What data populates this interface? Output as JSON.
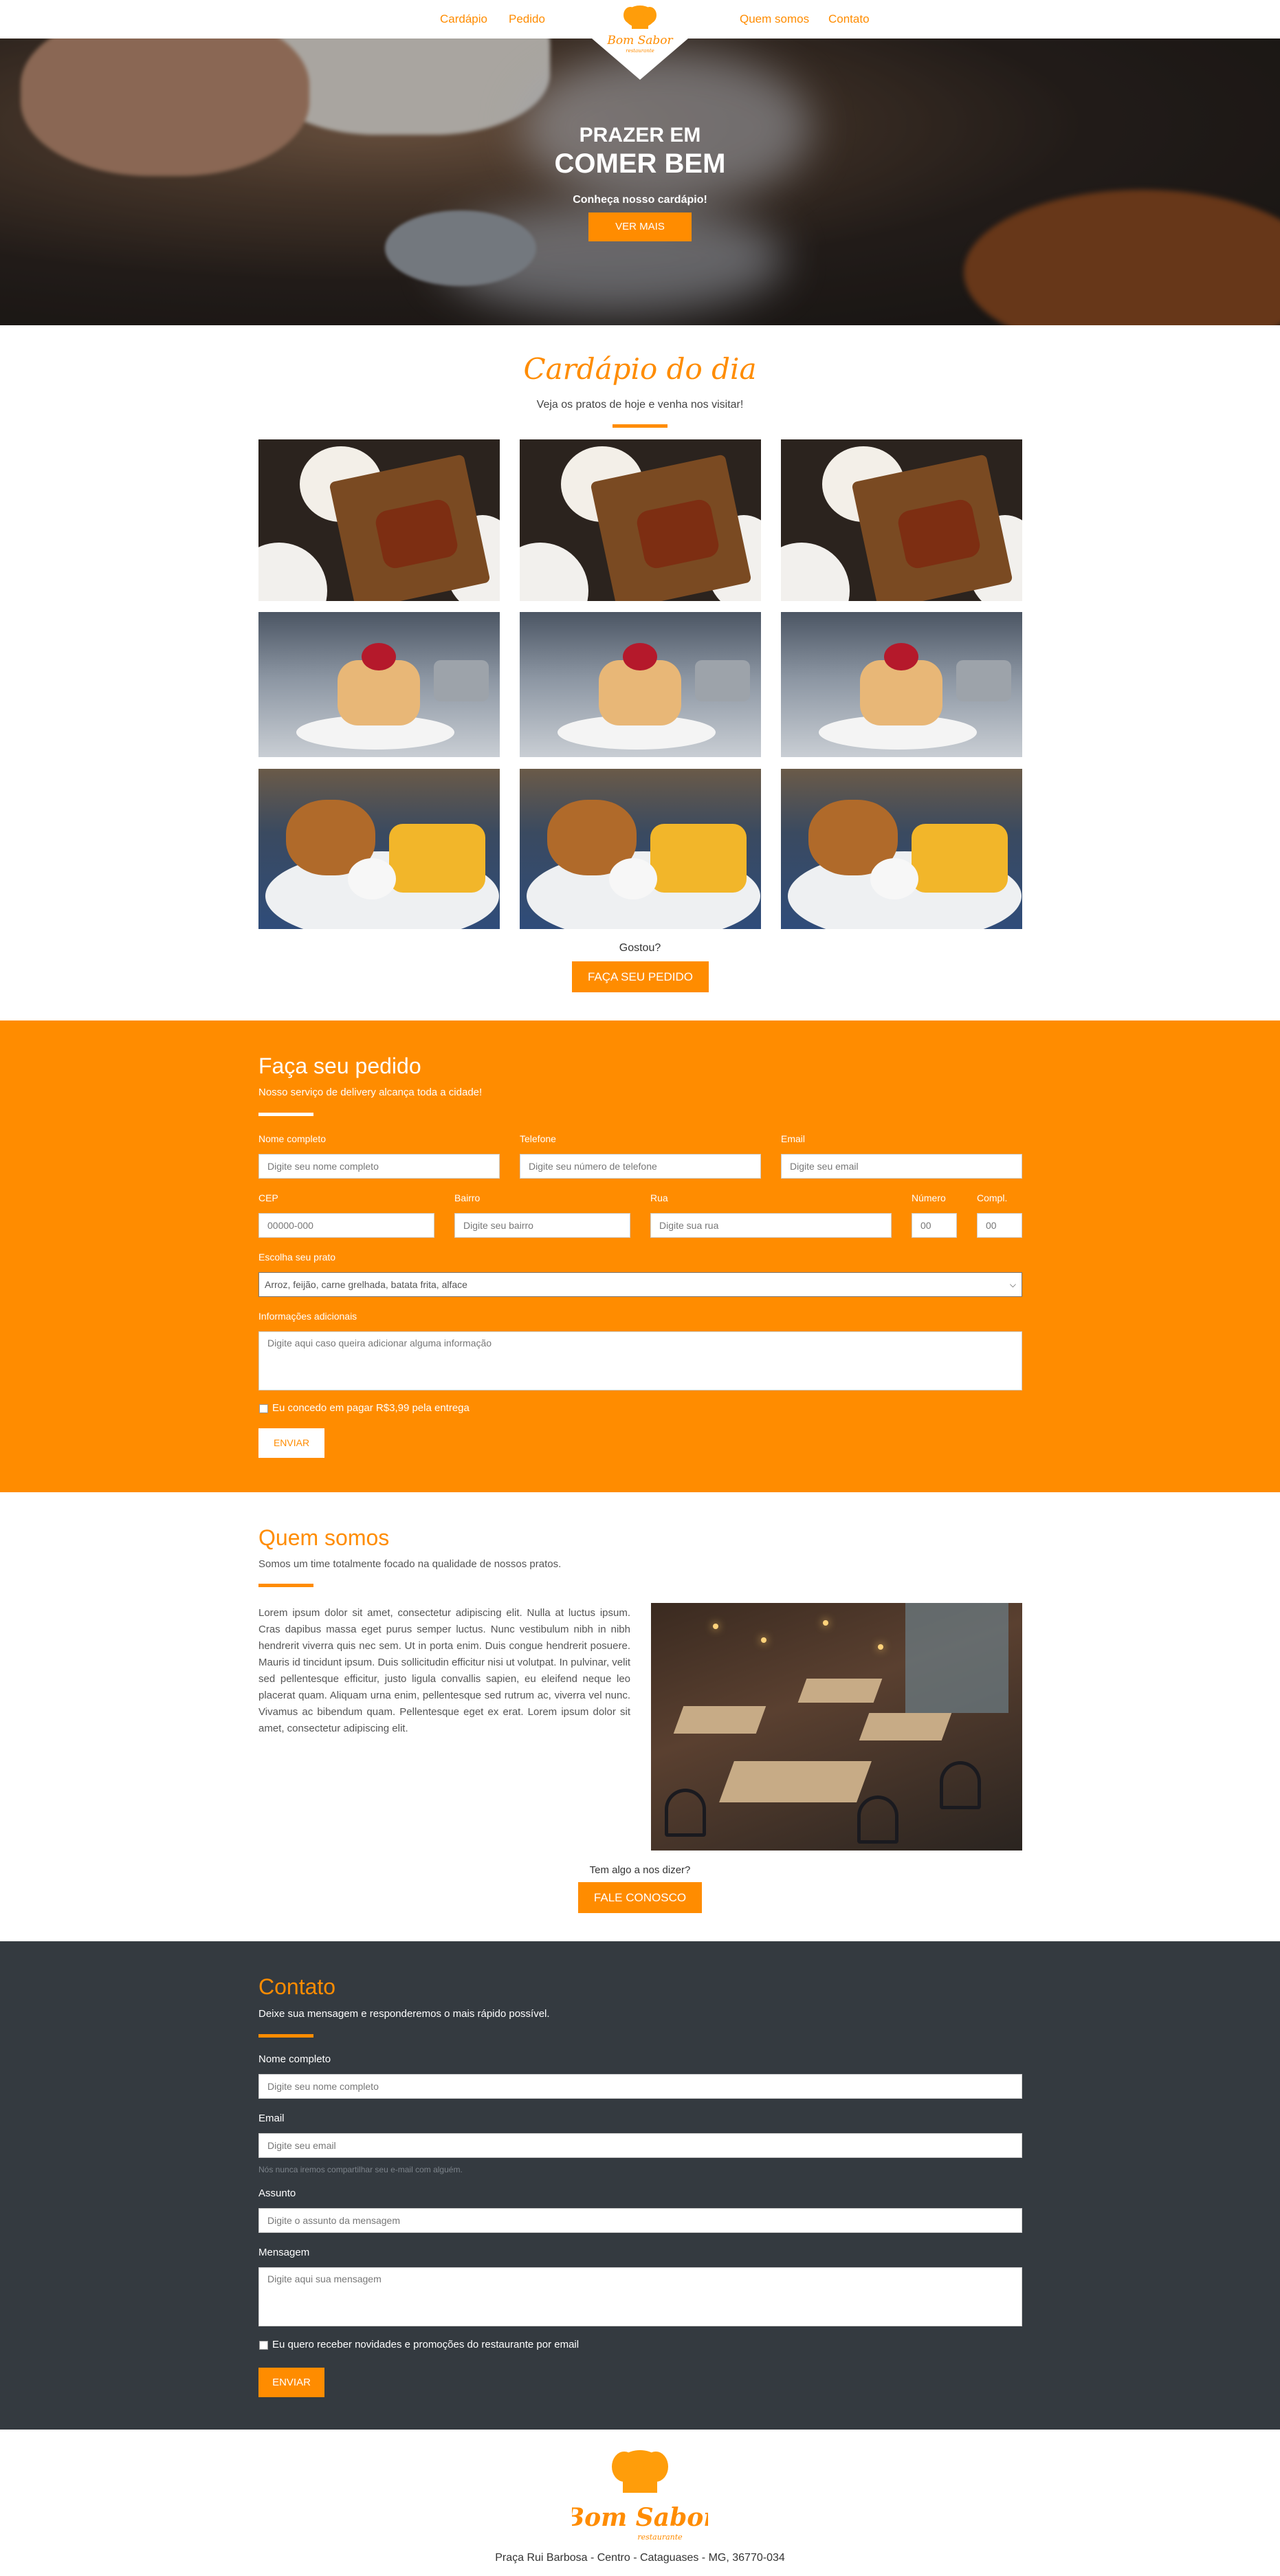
{
  "nav": {
    "links": [
      "Cardápio",
      "Pedido",
      "Quem somos",
      "Contato"
    ],
    "logo_text": "Bom Sabor",
    "logo_sub": "restaurante"
  },
  "hero": {
    "title1": "PRAZER EM",
    "title2": "COMER BEM",
    "subtitle": "Conheça nosso cardápio!",
    "button": "VER MAIS"
  },
  "cardapio": {
    "title": "Cardápio do dia",
    "subtitle": "Veja os pratos de hoje e venha nos visitar!",
    "question": "Gostou?",
    "button": "FAÇA SEU PEDIDO"
  },
  "pedido": {
    "title": "Faça seu pedido",
    "subtitle": "Nosso serviço de delivery alcança toda a cidade!",
    "nome_label": "Nome completo",
    "nome_placeholder": "Digite seu nome completo",
    "telefone_label": "Telefone",
    "telefone_placeholder": "Digite seu número de telefone",
    "email_label": "Email",
    "email_placeholder": "Digite seu email",
    "cep_label": "CEP",
    "cep_placeholder": "00000-000",
    "bairro_label": "Bairro",
    "bairro_placeholder": "Digite seu bairro",
    "rua_label": "Rua",
    "rua_placeholder": "Digite sua rua",
    "numero_label": "Número",
    "numero_placeholder": "00",
    "compl_label": "Compl.",
    "compl_placeholder": "00",
    "prato_label": "Escolha seu prato",
    "prato_value": "Arroz, feijão, carne grelhada, batata frita, alface",
    "info_label": "Informações adicionais",
    "info_placeholder": "Digite aqui caso queira adicionar alguma informação",
    "checkbox_label": "Eu concedo em pagar R$3,99 pela entrega",
    "button": "ENVIAR"
  },
  "quem": {
    "title": "Quem somos",
    "subtitle": "Somos um time totalmente focado na qualidade de nossos pratos.",
    "text": "Lorem ipsum dolor sit amet, consectetur adipiscing elit. Nulla at luctus ipsum. Cras dapibus massa eget purus semper luctus. Nunc vestibulum nibh in nibh hendrerit viverra quis nec sem. Ut in porta enim. Duis congue hendrerit posuere. Mauris id tincidunt ipsum. Duis sollicitudin efficitur nisi ut volutpat. In pulvinar, velit sed pellentesque efficitur, justo ligula convallis sapien, eu eleifend neque leo placerat quam. Aliquam urna enim, pellentesque sed rutrum ac, viverra vel nunc. Vivamus ac bibendum quam. Pellentesque eget ex erat. Lorem ipsum dolor sit amet, consectetur adipiscing elit.",
    "question": "Tem algo a nos dizer?",
    "button": "FALE CONOSCO"
  },
  "contato": {
    "title": "Contato",
    "subtitle": "Deixe sua mensagem e responderemos o mais rápido possível.",
    "nome_label": "Nome completo",
    "nome_placeholder": "Digite seu nome completo",
    "email_label": "Email",
    "email_placeholder": "Digite seu email",
    "email_help": "Nós nunca iremos compartilhar seu e-mail com alguém.",
    "assunto_label": "Assunto",
    "assunto_placeholder": "Digite o assunto da mensagem",
    "mensagem_label": "Mensagem",
    "mensagem_placeholder": "Digite aqui sua mensagem",
    "checkbox_label": "Eu quero receber novidades e promoções do restaurante por email",
    "button": "ENVIAR"
  },
  "footer": {
    "logo_text": "Bom Sabor",
    "logo_sub": "restaurante",
    "address": "Praça Rui Barbosa - Centro - Cataguases - MG, 36770-034"
  },
  "colors": {
    "accent": "#ff8c00",
    "dark": "#343a40"
  }
}
